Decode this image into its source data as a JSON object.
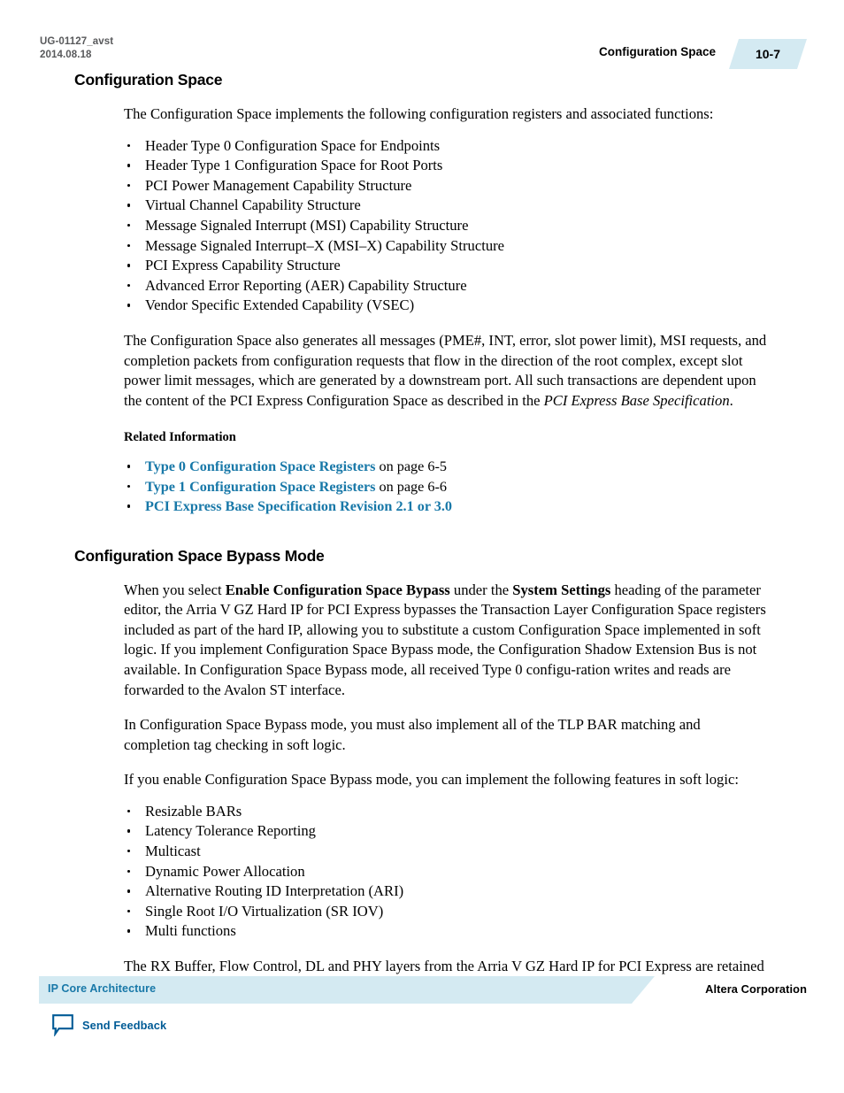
{
  "header": {
    "doc_id": "UG-01127_avst",
    "doc_date": "2014.08.18",
    "chapter_label": "Configuration Space",
    "page_number": "10-7",
    "tab_color": "#d4eaf2"
  },
  "section1": {
    "title": "Configuration Space",
    "intro": "The Configuration Space implements the following configuration registers and associated functions:",
    "bullets": [
      "Header Type 0 Configuration Space for Endpoints",
      "Header Type 1 Configuration Space for Root Ports",
      "PCI Power Management Capability Structure",
      "Virtual Channel Capability Structure",
      "Message Signaled Interrupt (MSI) Capability Structure",
      "Message Signaled Interrupt–X (MSI–X) Capability Structure",
      "PCI Express Capability Structure",
      "Advanced Error Reporting (AER) Capability Structure",
      "Vendor Specific Extended Capability (VSEC)"
    ],
    "para2_part1": "The Configuration Space also generates all messages (PME#, INT, error, slot power limit), MSI requests, and completion packets from configuration requests that flow in the direction of the root complex, except slot power limit messages, which are generated by a downstream port. All such transactions are dependent upon the content of the PCI Express Configuration Space as described in the ",
    "para2_italic": "PCI Express Base Specification",
    "para2_part2": ".",
    "related_heading": "Related Information",
    "related_links": [
      {
        "link_text": "Type 0 Configuration Space Registers",
        "suffix": " on page 6-5"
      },
      {
        "link_text": "Type 1 Configuration Space Registers",
        "suffix": " on page 6-6"
      },
      {
        "link_text": "PCI Express Base Specification Revision 2.1 or 3.0",
        "suffix": ""
      }
    ],
    "link_color": "#1878a8"
  },
  "section2": {
    "title": "Configuration Space Bypass Mode",
    "para1_a": "When you select ",
    "para1_b_bold": "Enable Configuration Space Bypass",
    "para1_c": " under the ",
    "para1_d_bold": "System Settings",
    "para1_e": " heading of the parameter editor, the Arria V GZ Hard IP for PCI Express bypasses the Transaction Layer Configuration Space registers included as part of the hard IP, allowing you to substitute a custom Configuration Space implemented in soft logic. If you implement Configuration Space Bypass mode, the Configuration Shadow Extension Bus is not available. In Configuration Space Bypass mode, all received Type 0 configu-ration writes and reads are forwarded to the Avalon ST interface.",
    "para2": "In Configuration Space Bypass mode, you must also implement all of the TLP BAR matching and completion tag checking in soft logic.",
    "para3": "If you enable Configuration Space Bypass mode, you can implement the following features in soft logic:",
    "bullets": [
      "Resizable BARs",
      "Latency Tolerance Reporting",
      "Multicast",
      "Dynamic Power Allocation",
      "Alternative Routing ID Interpretation (ARI)",
      "Single Root I/O Virtualization (SR IOV)",
      "Multi functions"
    ],
    "para4": "The RX Buffer, Flow Control, DL and PHY layers from the Arria V GZ Hard IP for PCI Express are retained in the Hard IP."
  },
  "footer": {
    "bar_label": "IP Core Architecture",
    "corporation": "Altera Corporation",
    "feedback_label": "Send Feedback",
    "bar_color": "#d4eaf2",
    "bar_text_color": "#1878a8",
    "feedback_color": "#005b96"
  }
}
